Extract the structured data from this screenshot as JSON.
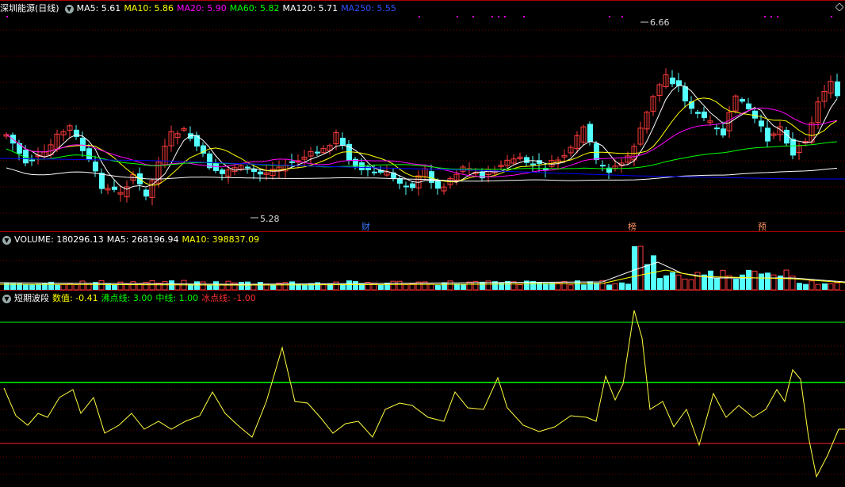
{
  "header_main": {
    "name": "深圳能源(日线)",
    "ma5": "MA5: 5.61",
    "ma10": "MA10: 5.86",
    "ma20": "MA20: 5.90",
    "ma60": "MA60: 5.82",
    "ma120": "MA120: 5.71",
    "ma250": "MA250: 5.55"
  },
  "header_volume": {
    "label": "VOLUME: 180296.13",
    "ma5": "MA5: 268196.94",
    "ma10": "MA10: 398837.09"
  },
  "header_indicator": {
    "name": "短期波段",
    "value": "数值: -0.41",
    "boil": "沸点线: 3.00",
    "mid": "中线: 1.00",
    "ice": "冰点线: -1.00"
  },
  "annotations": {
    "high": "6.66",
    "low": "5.28",
    "tag_cai": "财",
    "tag_bang": "榜",
    "tag_yu": "预"
  },
  "colors": {
    "ma5": "#ffffff",
    "ma10": "#ffff00",
    "ma20": "#ff00ff",
    "ma60": "#00ff00",
    "ma120": "#ffffff",
    "ma250": "#0000ff",
    "up": "#ff3c3c",
    "down": "#54ffff",
    "grid": "#7a0000"
  }
}
